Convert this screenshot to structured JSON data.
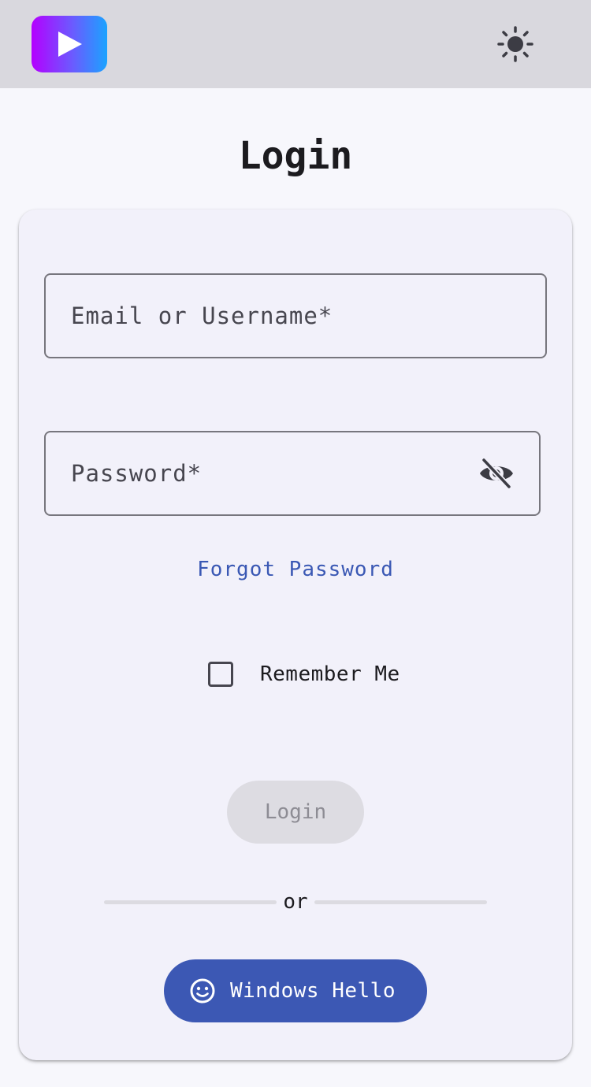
{
  "header": {
    "logo_icon": "play-icon",
    "theme_icon": "sun-icon",
    "colors": {
      "bar": "#d9d8de",
      "logo_start": "#b400ff",
      "logo_end": "#1aa3ff"
    }
  },
  "page": {
    "title": "Login"
  },
  "form": {
    "email_placeholder": "Email or Username*",
    "email_value": "",
    "password_placeholder": "Password*",
    "password_value": "",
    "password_toggle_icon": "eye-off-icon",
    "forgot_label": "Forgot Password",
    "remember_label": "Remember Me",
    "remember_checked": false,
    "login_label": "Login",
    "login_disabled": true,
    "divider_label": "or",
    "windows_hello_label": "Windows Hello",
    "windows_hello_icon": "smiley-face-icon",
    "colors": {
      "accent": "#3c58b4",
      "link": "#3a58b4",
      "disabled_bg": "#dddce2"
    }
  }
}
